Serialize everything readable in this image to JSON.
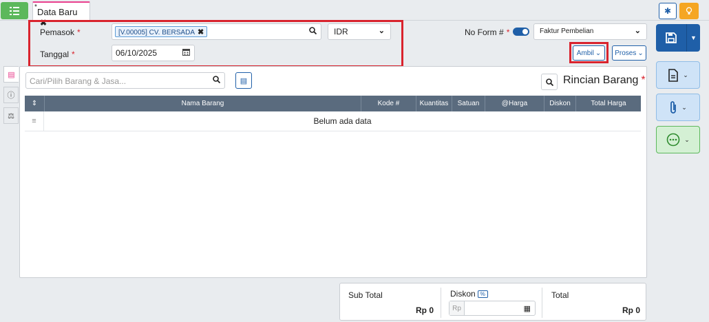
{
  "tab": {
    "modified_mark": "*",
    "title": "Data Baru",
    "close": "✖"
  },
  "form": {
    "supplier_label": "Pemasok",
    "supplier_tag": "[V.00005] CV. BERSADA",
    "date_label": "Tanggal",
    "date_value": "06/10/2025",
    "currency_value": "IDR",
    "required_mark": "*",
    "form_no_label": "No Form #",
    "form_type_value": "Faktur Pembelian",
    "ambil_label": "Ambil",
    "proses_label": "Proses"
  },
  "detail": {
    "search_placeholder": "Cari/Pilih Barang & Jasa...",
    "title": "Rincian Barang",
    "columns": [
      "Nama Barang",
      "Kode #",
      "Kuantitas",
      "Satuan",
      "@Harga",
      "Diskon",
      "Total Harga"
    ],
    "sort_icon": "⇕",
    "empty_text": "Belum ada data"
  },
  "totals": {
    "subtotal_label": "Sub Total",
    "subtotal_value": "Rp 0",
    "discount_label": "Diskon",
    "discount_pct": "%",
    "discount_currency": "Rp",
    "total_label": "Total",
    "total_value": "Rp 0"
  },
  "colors": {
    "brand_blue": "#1f5fa8",
    "green": "#5cb85c",
    "orange": "#f5a623",
    "highlight_red": "#d9232d",
    "header_gray": "#5a6b7e"
  }
}
